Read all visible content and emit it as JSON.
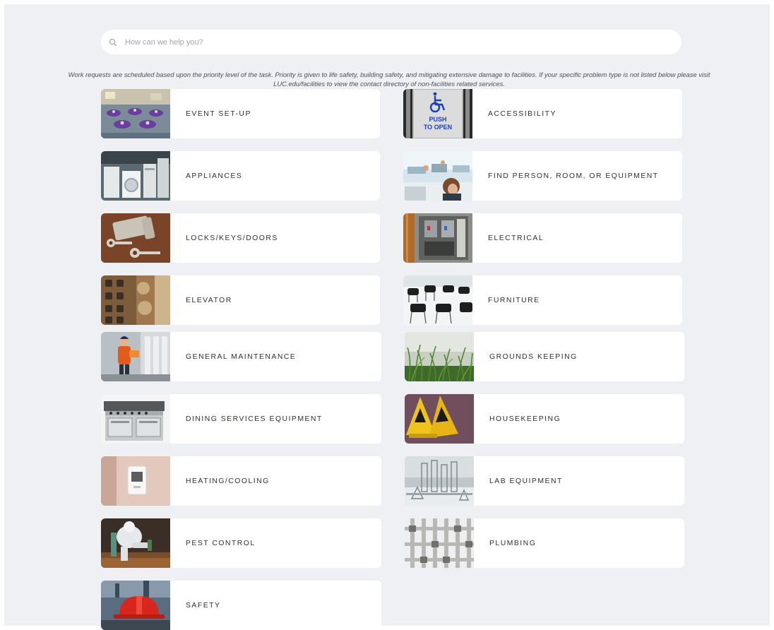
{
  "search": {
    "placeholder": "How can we help you?"
  },
  "notice": {
    "line1": "Work requests are scheduled based upon the priority level of the task. Priority is given to life safety, building safety, and mitigating extensive damage to facilities. If your specific problem type is not listed below please visit",
    "line2": "LUC.edu/facilities to view the contact directory of non-facilities related services."
  },
  "categories": [
    {
      "label": "EVENT SET-UP",
      "image": "event-ballroom-image"
    },
    {
      "label": "ACCESSIBILITY",
      "image": "push-to-open-button-image",
      "image_text": [
        "PUSH",
        "TO OPEN"
      ]
    },
    {
      "label": "APPLIANCES",
      "image": "appliances-image"
    },
    {
      "label": "FIND PERSON, ROOM, OR EQUIPMENT",
      "image": "office-workers-image"
    },
    {
      "label": "LOCKS/KEYS/DOORS",
      "image": "lock-and-keys-image"
    },
    {
      "label": "ELECTRICAL",
      "image": "electrical-panel-image"
    },
    {
      "label": "ELEVATOR",
      "image": "elevator-buttons-image"
    },
    {
      "label": "FURNITURE",
      "image": "chairs-image"
    },
    {
      "label": "GENERAL MAINTENANCE",
      "image": "maintenance-workers-image"
    },
    {
      "label": "GROUNDS KEEPING",
      "image": "grass-image"
    },
    {
      "label": "DINING SERVICES EQUIPMENT",
      "image": "kitchen-range-image"
    },
    {
      "label": "HOUSEKEEPING",
      "image": "wet-floor-sign-image"
    },
    {
      "label": "HEATING/COOLING",
      "image": "thermostat-image"
    },
    {
      "label": "LAB EQUIPMENT",
      "image": "lab-glassware-image"
    },
    {
      "label": "PEST CONTROL",
      "image": "pest-control-worker-image"
    },
    {
      "label": "PLUMBING",
      "image": "pipes-image"
    },
    {
      "label": "SAFETY",
      "image": "hard-hat-image"
    }
  ]
}
